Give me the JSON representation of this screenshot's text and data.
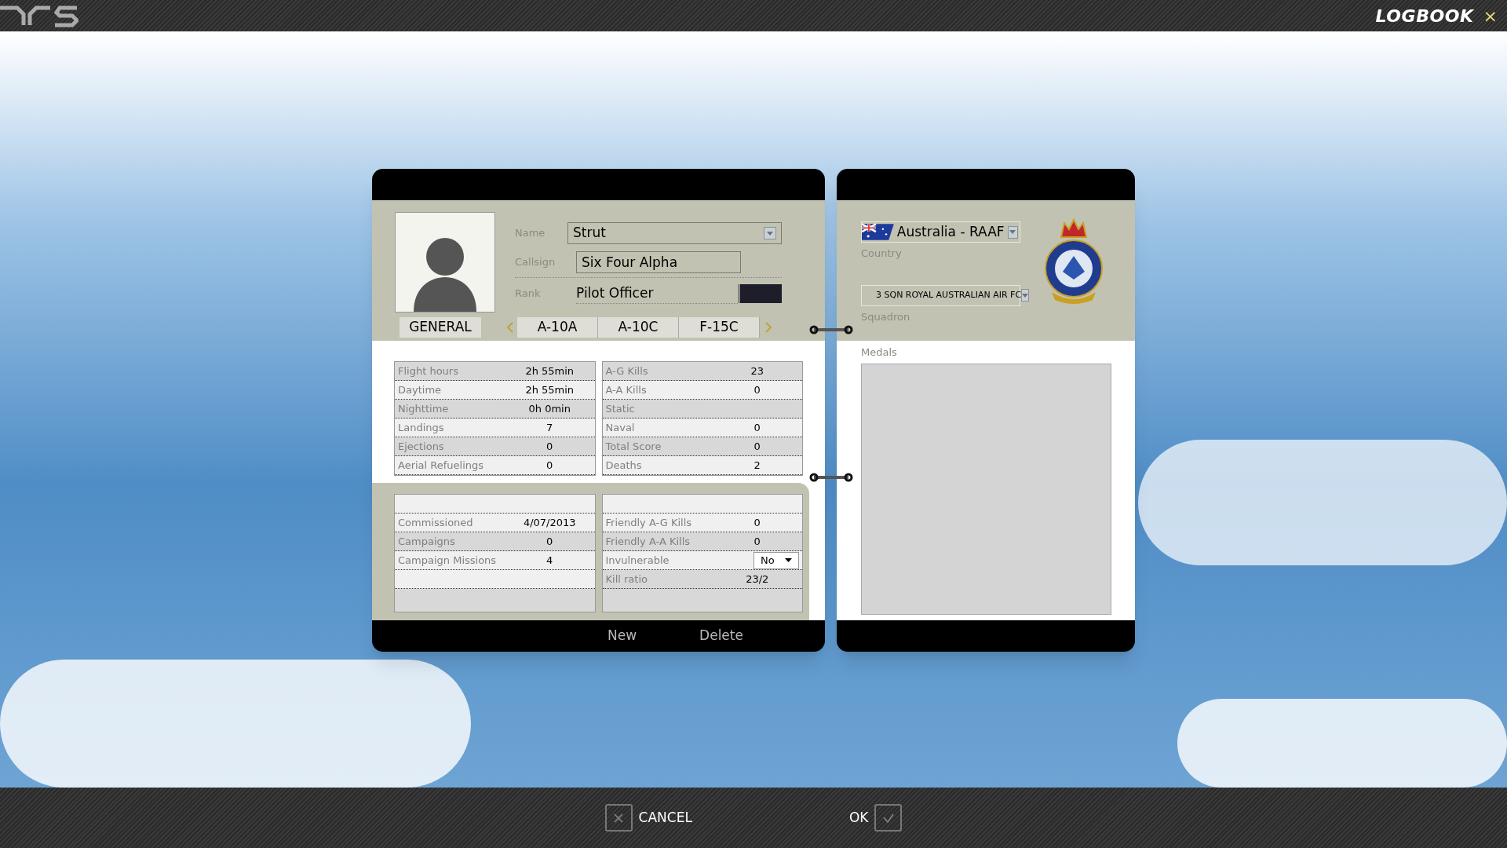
{
  "window": {
    "title": "LOGBOOK",
    "close": "×"
  },
  "pilot": {
    "fields": [
      {
        "label": "Name",
        "value": "Strut",
        "kind": "dropdown"
      },
      {
        "label": "Callsign",
        "value": "Six Four Alpha",
        "kind": "input"
      },
      {
        "label": "Rank",
        "value": "Pilot Officer",
        "kind": "rank"
      }
    ]
  },
  "tabs": [
    {
      "label": "GENERAL",
      "selected": true
    },
    {
      "label": "A-10A",
      "selected": false
    },
    {
      "label": "A-10C",
      "selected": false
    },
    {
      "label": "F-15C",
      "selected": false
    }
  ],
  "stats_left": [
    {
      "label": "Flight hours",
      "value": "2h 55min"
    },
    {
      "label": "Daytime",
      "value": "2h 55min"
    },
    {
      "label": "Nighttime",
      "value": "0h 0min"
    },
    {
      "label": "Landings",
      "value": "7"
    },
    {
      "label": "Ejections",
      "value": "0"
    },
    {
      "label": "Aerial Refuelings",
      "value": "0"
    }
  ],
  "stats_right": [
    {
      "label": "A-G Kills",
      "value": "23"
    },
    {
      "label": "A-A Kills",
      "value": "0"
    },
    {
      "label": "Static"
    },
    {
      "label": "Naval",
      "value": "0"
    },
    {
      "label": "Total Score",
      "value": "0"
    },
    {
      "label": "Deaths",
      "value": "2"
    }
  ],
  "career_left": [
    {
      "label": "Commissioned",
      "value": "4/07/2013"
    },
    {
      "label": "Campaigns",
      "value": "0"
    },
    {
      "label": "Campaign Missions",
      "value": "4"
    }
  ],
  "career_right": [
    {
      "label": "Friendly A-G Kills",
      "value": "0",
      "kind": "text"
    },
    {
      "label": "Friendly A-A Kills",
      "value": "0",
      "kind": "text"
    },
    {
      "label": "Invulnerable",
      "value": "No",
      "kind": "select"
    },
    {
      "label": "Kill ratio",
      "value": "23/2",
      "kind": "text"
    }
  ],
  "page_actions": [
    "New",
    "Delete"
  ],
  "country": {
    "value": "Australia - RAAF",
    "label": "Country"
  },
  "squadron": {
    "value": "3 SQN ROYAL AUSTRALIAN AIR FC",
    "label": "Squadron"
  },
  "medals": {
    "label": "Medals"
  },
  "footer": {
    "cancel": "CANCEL",
    "ok": "OK"
  }
}
